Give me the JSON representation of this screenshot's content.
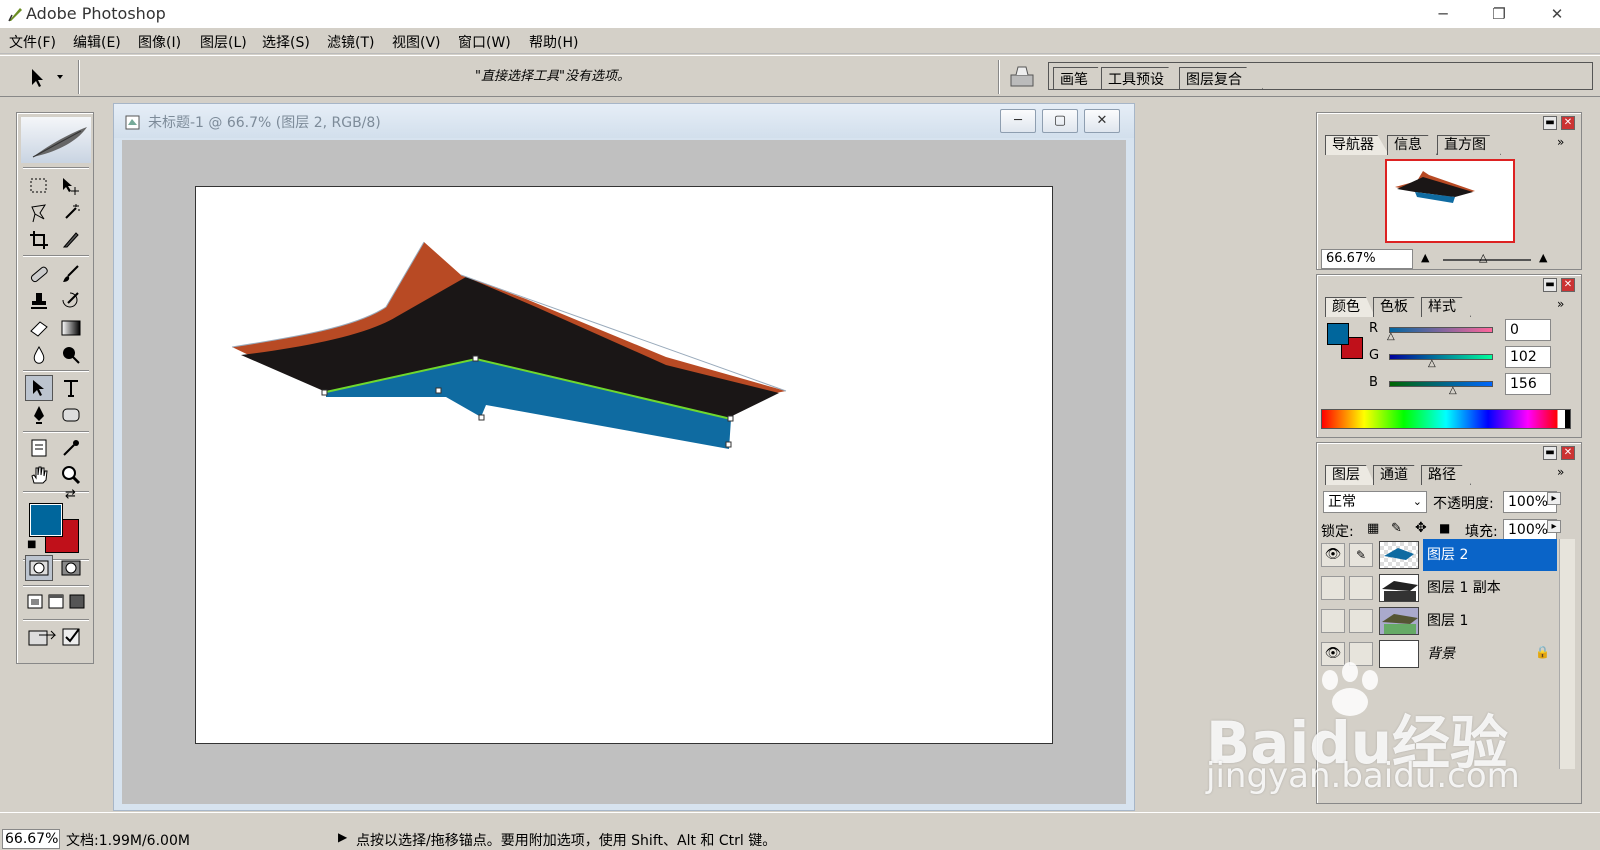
{
  "app": {
    "title": "Adobe Photoshop",
    "window_controls": [
      "─",
      "❐",
      "✕"
    ]
  },
  "menu": [
    "文件(F)",
    "编辑(E)",
    "图像(I)",
    "图层(L)",
    "选择(S)",
    "滤镜(T)",
    "视图(V)",
    "窗口(W)",
    "帮助(H)"
  ],
  "options": {
    "message": "\"直接选择工具\"没有选项。",
    "palette_tabs": [
      "画笔",
      "工具预设",
      "图层复合"
    ]
  },
  "document": {
    "title": "未标题-1 @ 66.7% (图层 2, RGB/8)",
    "buttons": [
      "─",
      "▢",
      "✕"
    ]
  },
  "navigator": {
    "tabs": [
      "导航器",
      "信息",
      "直方图"
    ],
    "zoom": "66.67%"
  },
  "color": {
    "tabs": [
      "颜色",
      "色板",
      "样式"
    ],
    "channels": [
      {
        "label": "R",
        "value": "0"
      },
      {
        "label": "G",
        "value": "102"
      },
      {
        "label": "B",
        "value": "156"
      }
    ],
    "foreground": "#00669c",
    "background": "#c0101a"
  },
  "layers": {
    "tabs": [
      "图层",
      "通道",
      "路径"
    ],
    "blend_mode": "正常",
    "opacity_label": "不透明度:",
    "opacity": "100%",
    "lock_label": "锁定:",
    "fill_label": "填充:",
    "fill": "100%",
    "items": [
      {
        "name": "图层 2",
        "visible": true,
        "selected": true
      },
      {
        "name": "图层 1 副本",
        "visible": false,
        "selected": false
      },
      {
        "name": "图层 1",
        "visible": false,
        "selected": false
      },
      {
        "name": "背景",
        "visible": true,
        "selected": false,
        "locked": true
      }
    ]
  },
  "status": {
    "zoom": "66.67%",
    "doc": "文档:1.99M/6.00M",
    "hint": "点按以选择/拖移锚点。要用附加选项，使用 Shift、Alt 和 Ctrl 键。"
  },
  "watermark": {
    "logo": "Baidu经验",
    "url": "jingyan.baidu.com"
  }
}
